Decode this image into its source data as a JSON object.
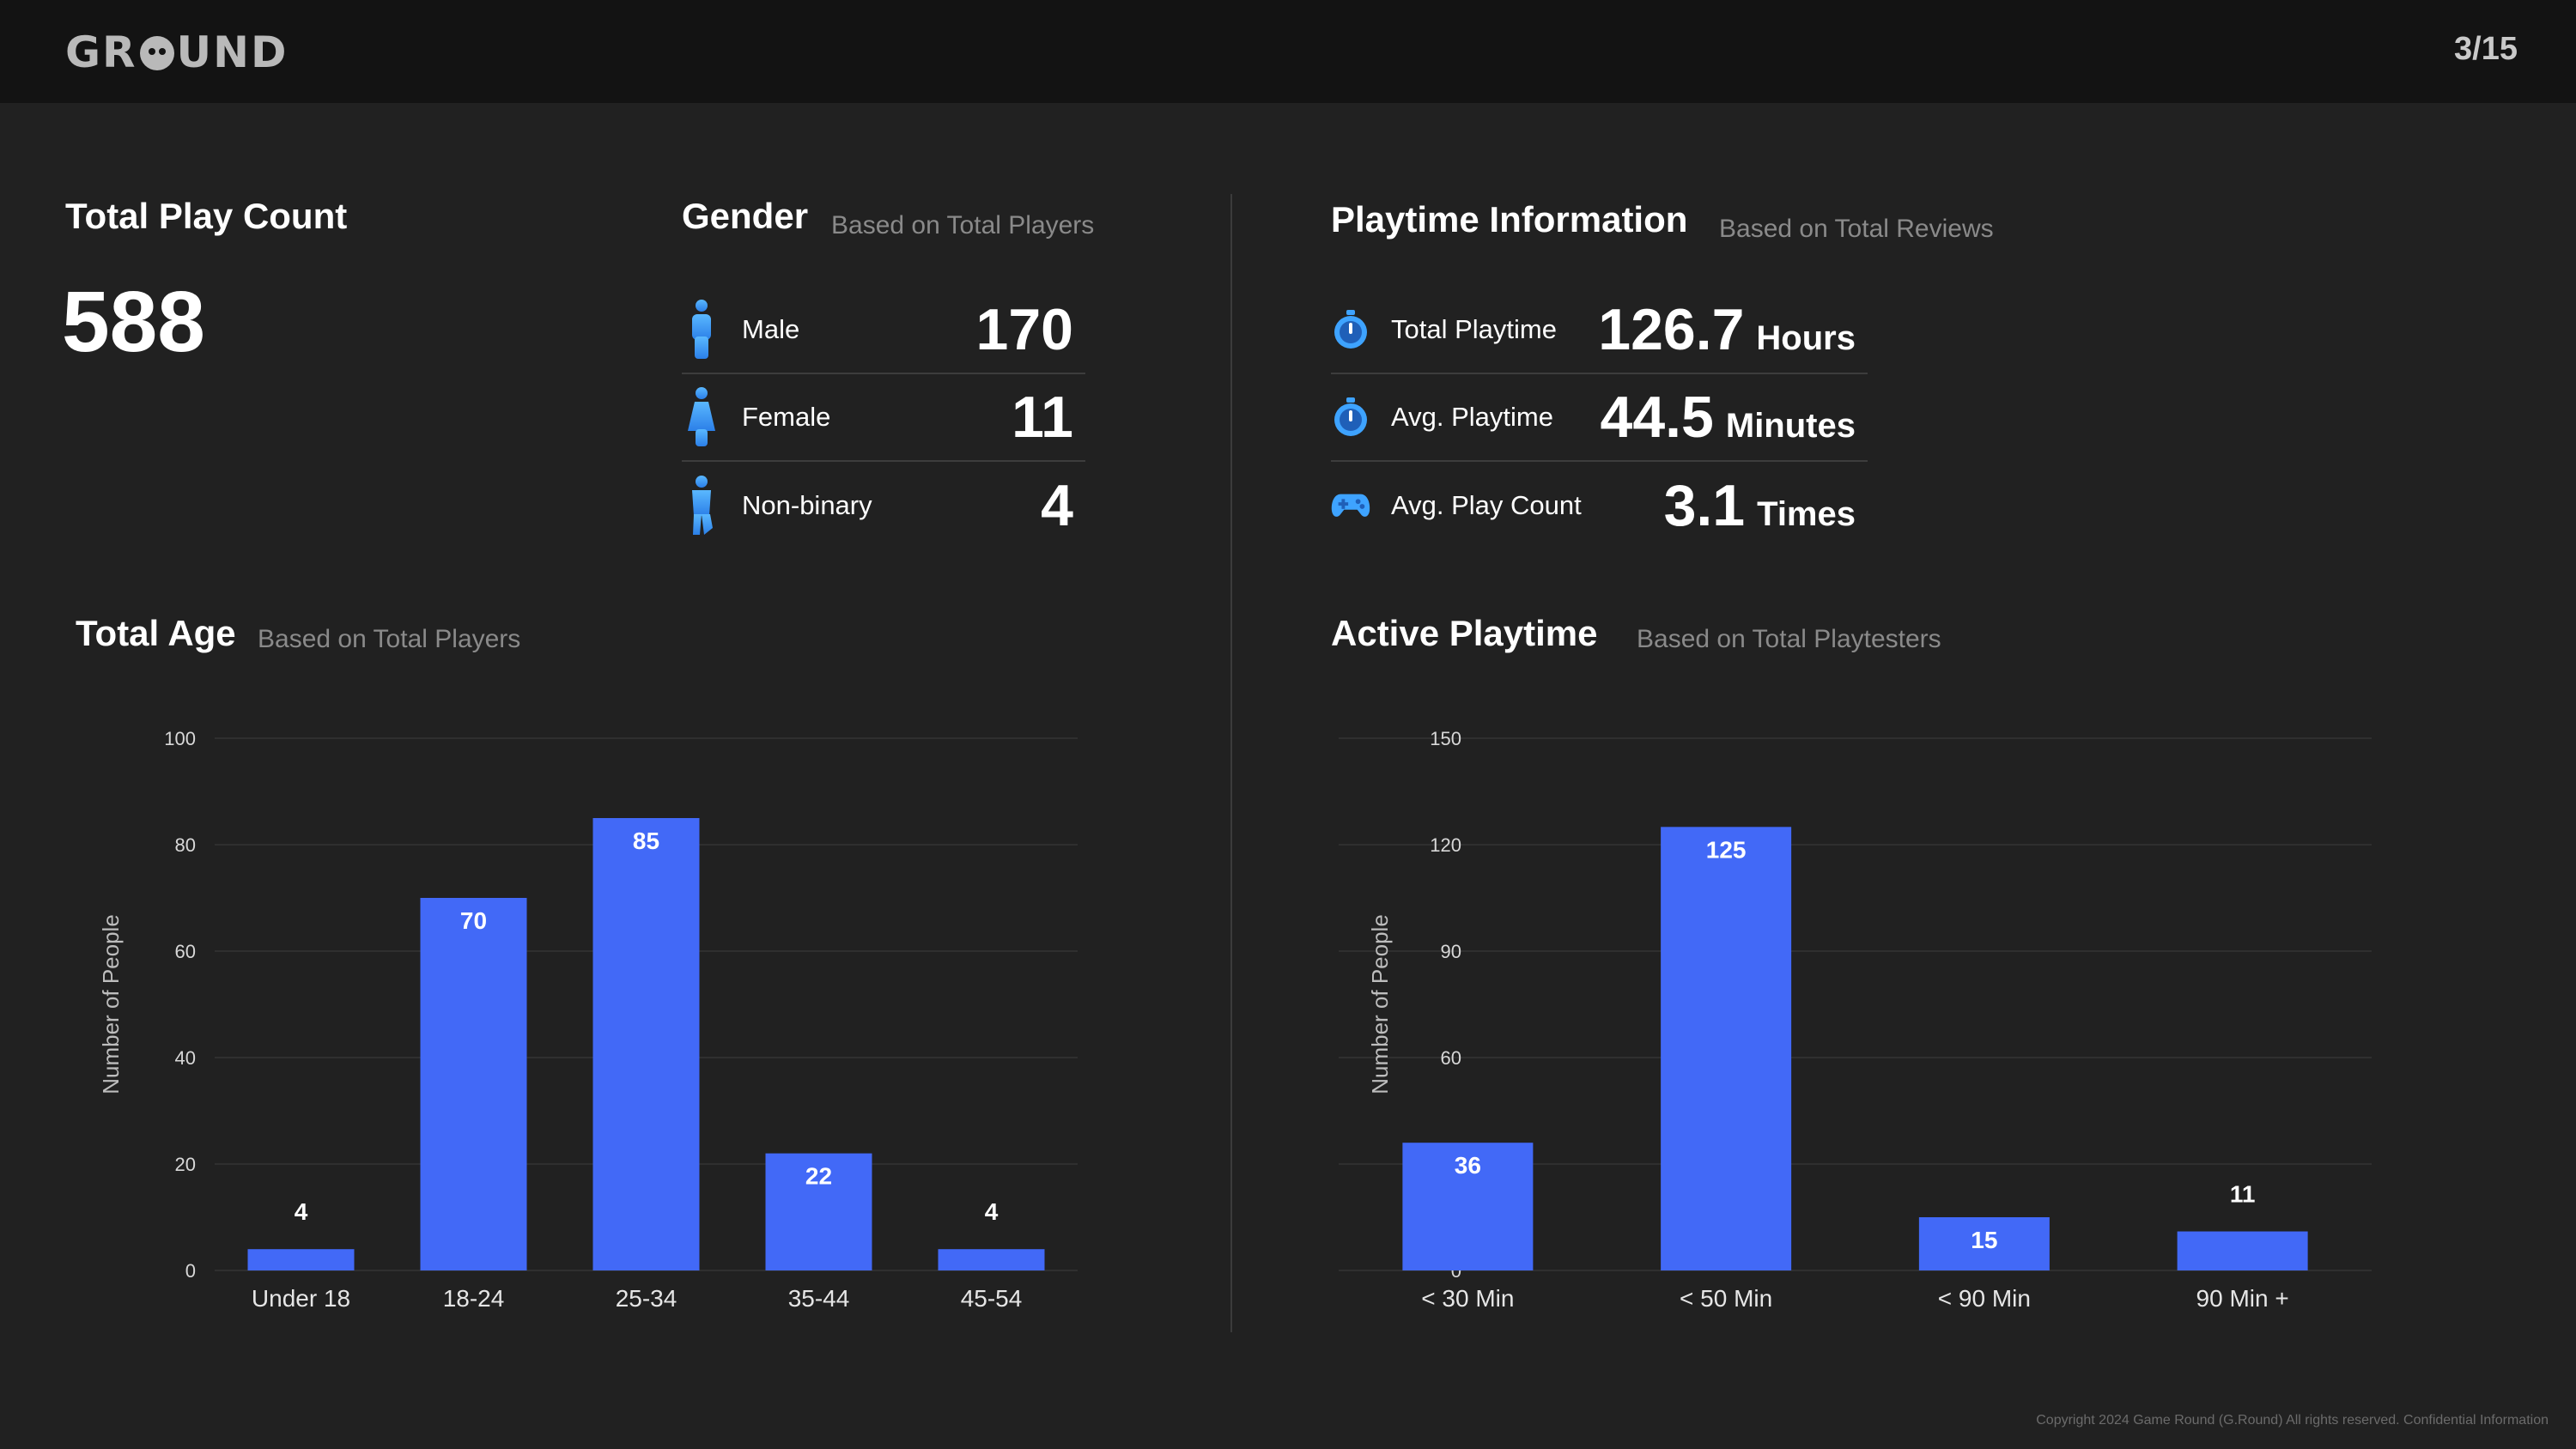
{
  "header": {
    "logo_text_left": "GR",
    "logo_text_right": "UND",
    "page_indicator": "3/15"
  },
  "total_play_count": {
    "title": "Total Play Count",
    "value": "588"
  },
  "gender": {
    "title": "Gender",
    "subtitle": "Based on Total Players",
    "rows": [
      {
        "icon": "male-person-icon",
        "label": "Male",
        "value": "170"
      },
      {
        "icon": "female-person-icon",
        "label": "Female",
        "value": "11"
      },
      {
        "icon": "nonbinary-person-icon",
        "label": "Non-binary",
        "value": "4"
      }
    ]
  },
  "playtime_info": {
    "title": "Playtime Information",
    "subtitle": "Based on Total Reviews",
    "rows": [
      {
        "icon": "stopwatch-icon",
        "label": "Total Playtime",
        "value": "126.7",
        "unit": "Hours"
      },
      {
        "icon": "stopwatch-icon",
        "label": "Avg. Playtime",
        "value": "44.5",
        "unit": "Minutes"
      },
      {
        "icon": "gamepad-icon",
        "label": "Avg. Play Count",
        "value": "3.1",
        "unit": "Times"
      }
    ]
  },
  "colors": {
    "bar": "#4269f7",
    "icon_blue": "#3ea3ff",
    "background": "#212121",
    "topbar": "#131313"
  },
  "chart_data": [
    {
      "type": "bar",
      "title": "Total Age",
      "subtitle": "Based on Total Players",
      "ylabel": "Number of People",
      "xlabel": "",
      "categories": [
        "Under 18",
        "18-24",
        "25-34",
        "35-44",
        "45-54"
      ],
      "values": [
        4,
        70,
        85,
        22,
        4
      ],
      "ylim": [
        0,
        100
      ],
      "yticks": [
        0,
        20,
        40,
        60,
        80,
        100
      ],
      "grid": true
    },
    {
      "type": "bar",
      "title": "Active Playtime",
      "subtitle": "Based on Total Playtesters",
      "ylabel": "Number of People",
      "xlabel": "",
      "categories": [
        "< 30 Min",
        "< 50 Min",
        "< 90 Min",
        "90 Min +"
      ],
      "values": [
        36,
        125,
        15,
        11
      ],
      "ylim": [
        0,
        150
      ],
      "yticks": [
        0,
        30,
        60,
        90,
        120,
        150
      ],
      "grid": true
    }
  ],
  "footer": {
    "copyright": "Copyright 2024 Game Round (G.Round)  All rights reserved. Confidential Information"
  }
}
